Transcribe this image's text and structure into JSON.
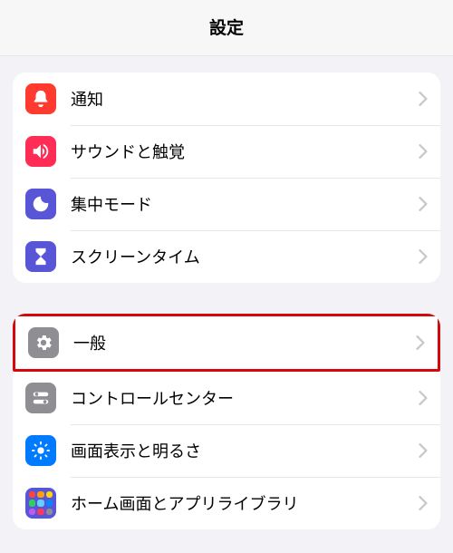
{
  "header": {
    "title": "設定"
  },
  "group1": [
    {
      "label": "通知"
    },
    {
      "label": "サウンドと触覚"
    },
    {
      "label": "集中モード"
    },
    {
      "label": "スクリーンタイム"
    }
  ],
  "group2": [
    {
      "label": "一般"
    },
    {
      "label": "コントロールセンター"
    },
    {
      "label": "画面表示と明るさ"
    },
    {
      "label": "ホーム画面とアプリライブラリ"
    }
  ]
}
